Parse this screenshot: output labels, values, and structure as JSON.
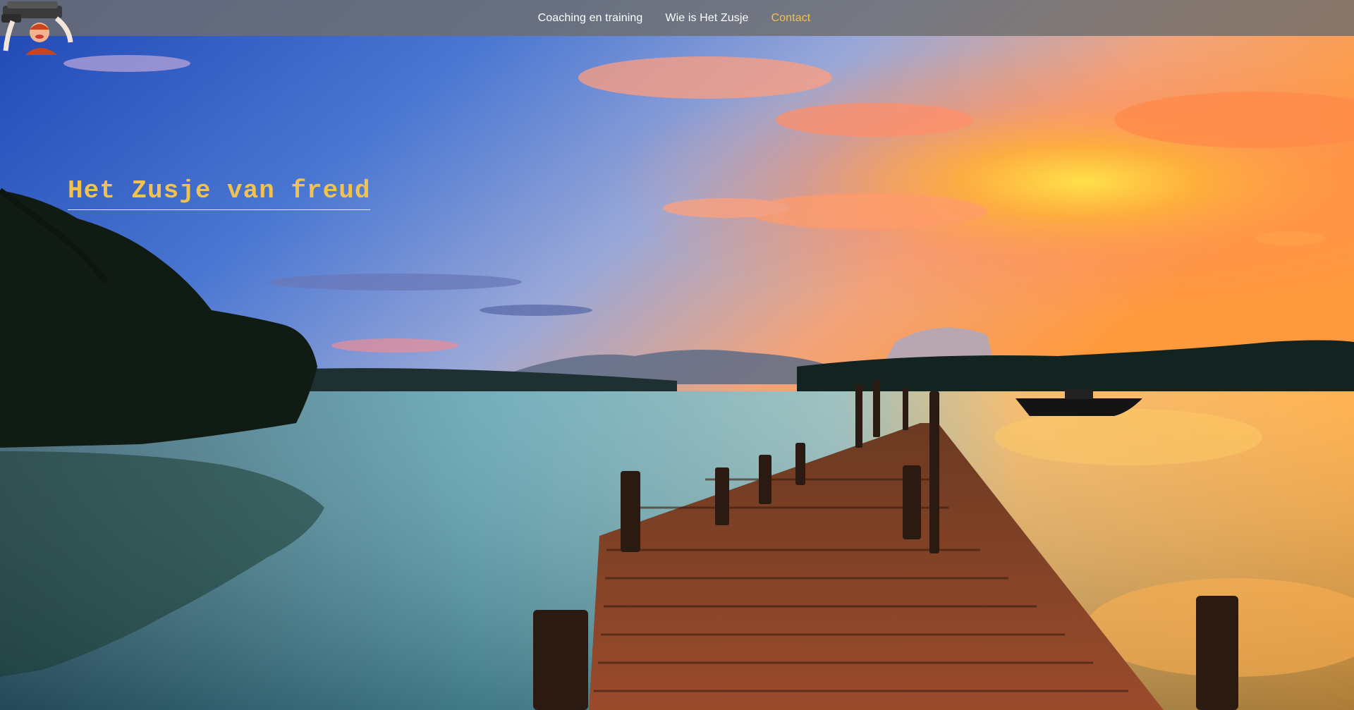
{
  "nav": {
    "items": [
      {
        "label": "Coaching en training"
      },
      {
        "label": "Wie is Het Zusje"
      },
      {
        "label": "Contact",
        "active": true
      }
    ]
  },
  "hero": {
    "title": "Het Zusje van freud"
  },
  "colors": {
    "accent": "#f2c14e",
    "nav_bg": "#6e6e6e"
  },
  "icons": {
    "logo": "logo-woman-with-books"
  }
}
